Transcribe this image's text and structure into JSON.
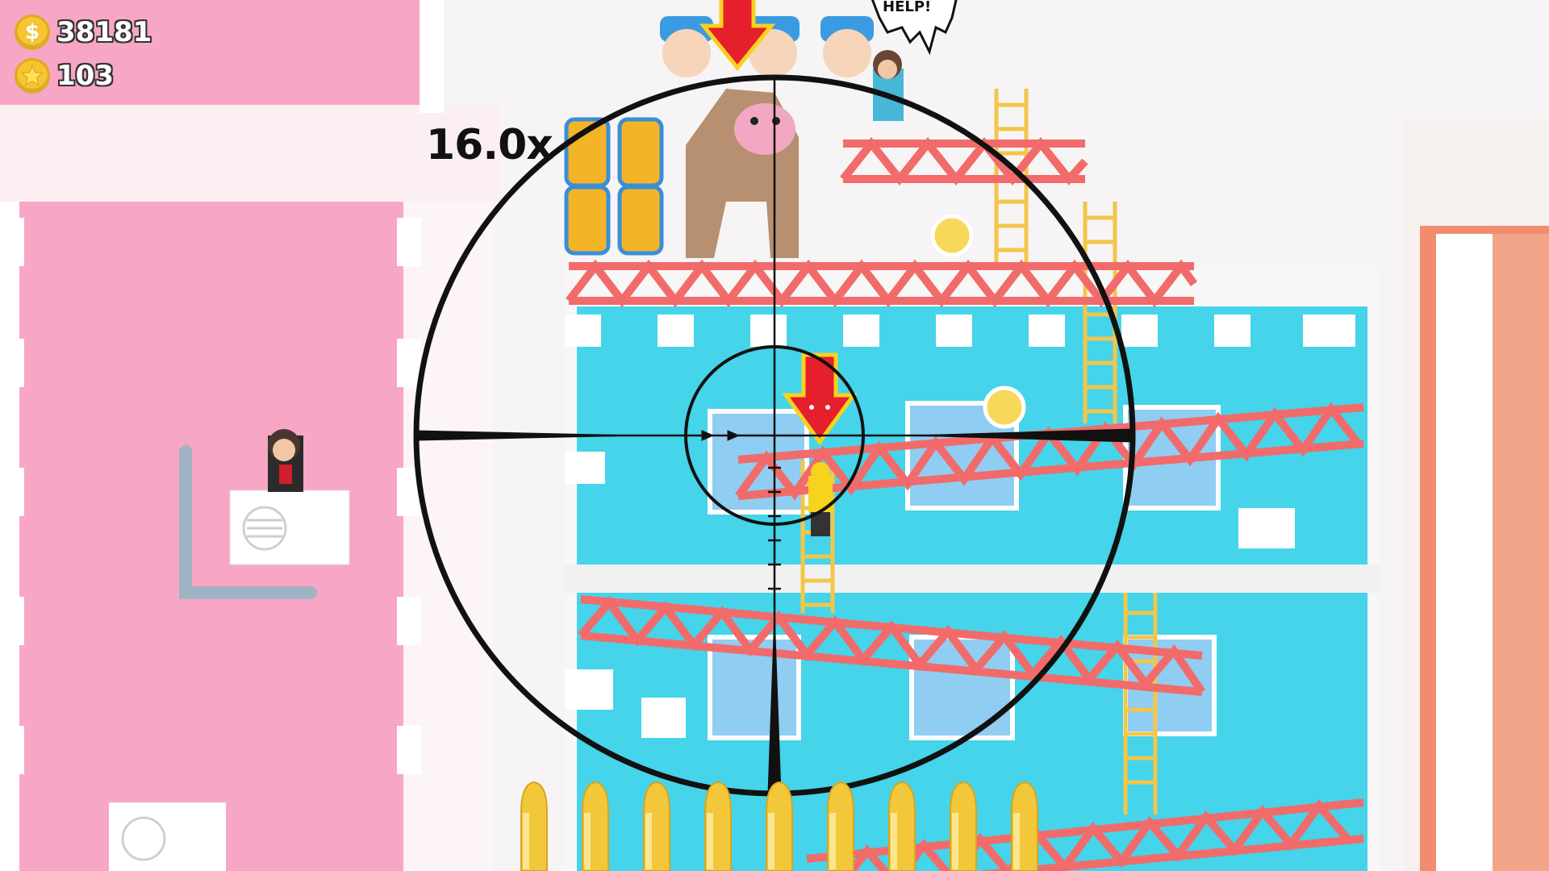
{
  "hud": {
    "coins": "38181",
    "stars": "103",
    "coin_symbol": "$"
  },
  "scope": {
    "zoom": "16.0x"
  },
  "speech": {
    "help": "HELP!"
  },
  "ammo": {
    "remaining": 9
  },
  "colors": {
    "pink_building": "#f7a6c6",
    "cyan_building": "#45d4ea",
    "girder_red": "#f26b6b",
    "ladder_yellow": "#f3c64a",
    "bullet_gold": "#f3c73a",
    "target_marker": "#e51f2c",
    "crosshair": "#111111"
  },
  "icons": {
    "coin": "dollar-coin-icon",
    "star": "star-icon",
    "target": "target-arrow-icon"
  }
}
